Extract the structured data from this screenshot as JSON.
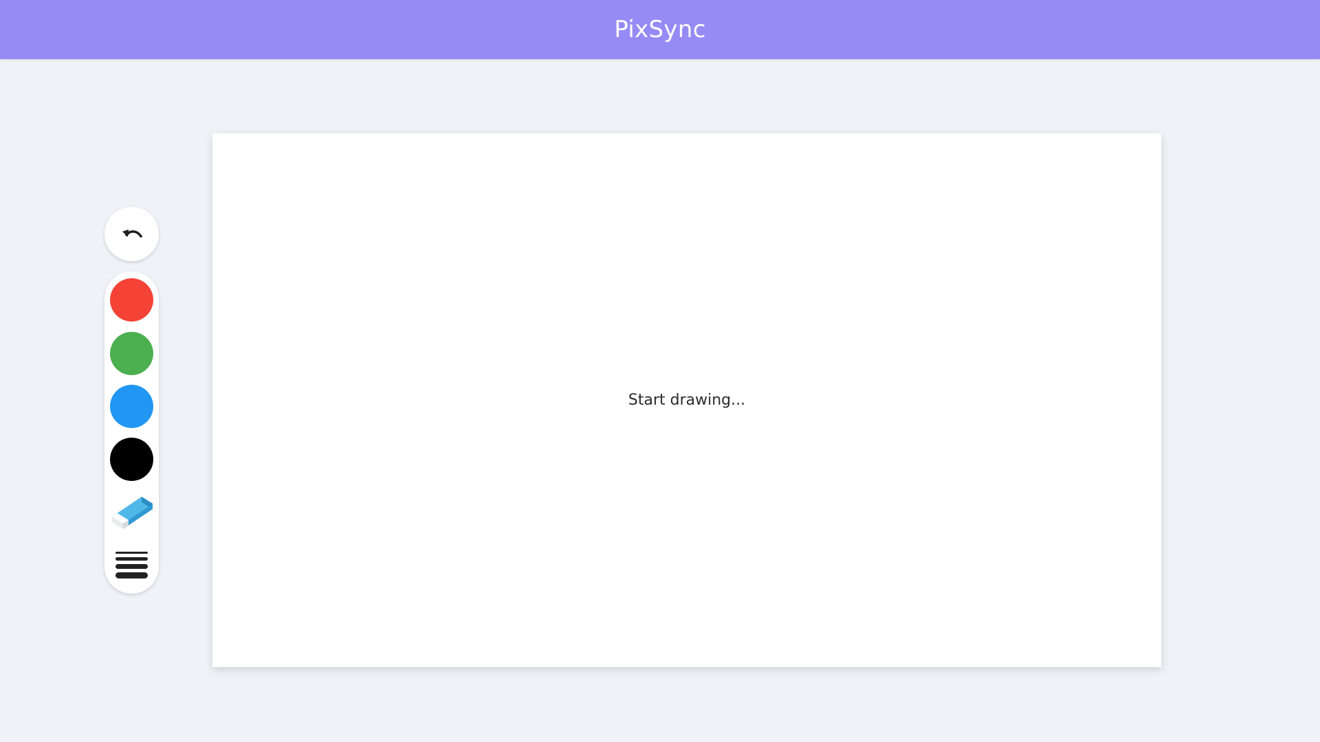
{
  "header": {
    "title": "PixSync",
    "background": "#968bf5"
  },
  "canvas": {
    "placeholder": "Start drawing..."
  },
  "toolbar": {
    "undo_icon": "undo-icon",
    "colors": [
      {
        "name": "red",
        "hex": "#f44336"
      },
      {
        "name": "green",
        "hex": "#4caf50"
      },
      {
        "name": "blue",
        "hex": "#2196f3"
      },
      {
        "name": "black",
        "hex": "#000000"
      }
    ],
    "eraser_icon": "eraser-icon",
    "brush_size_icon": "brush-size-icon"
  }
}
